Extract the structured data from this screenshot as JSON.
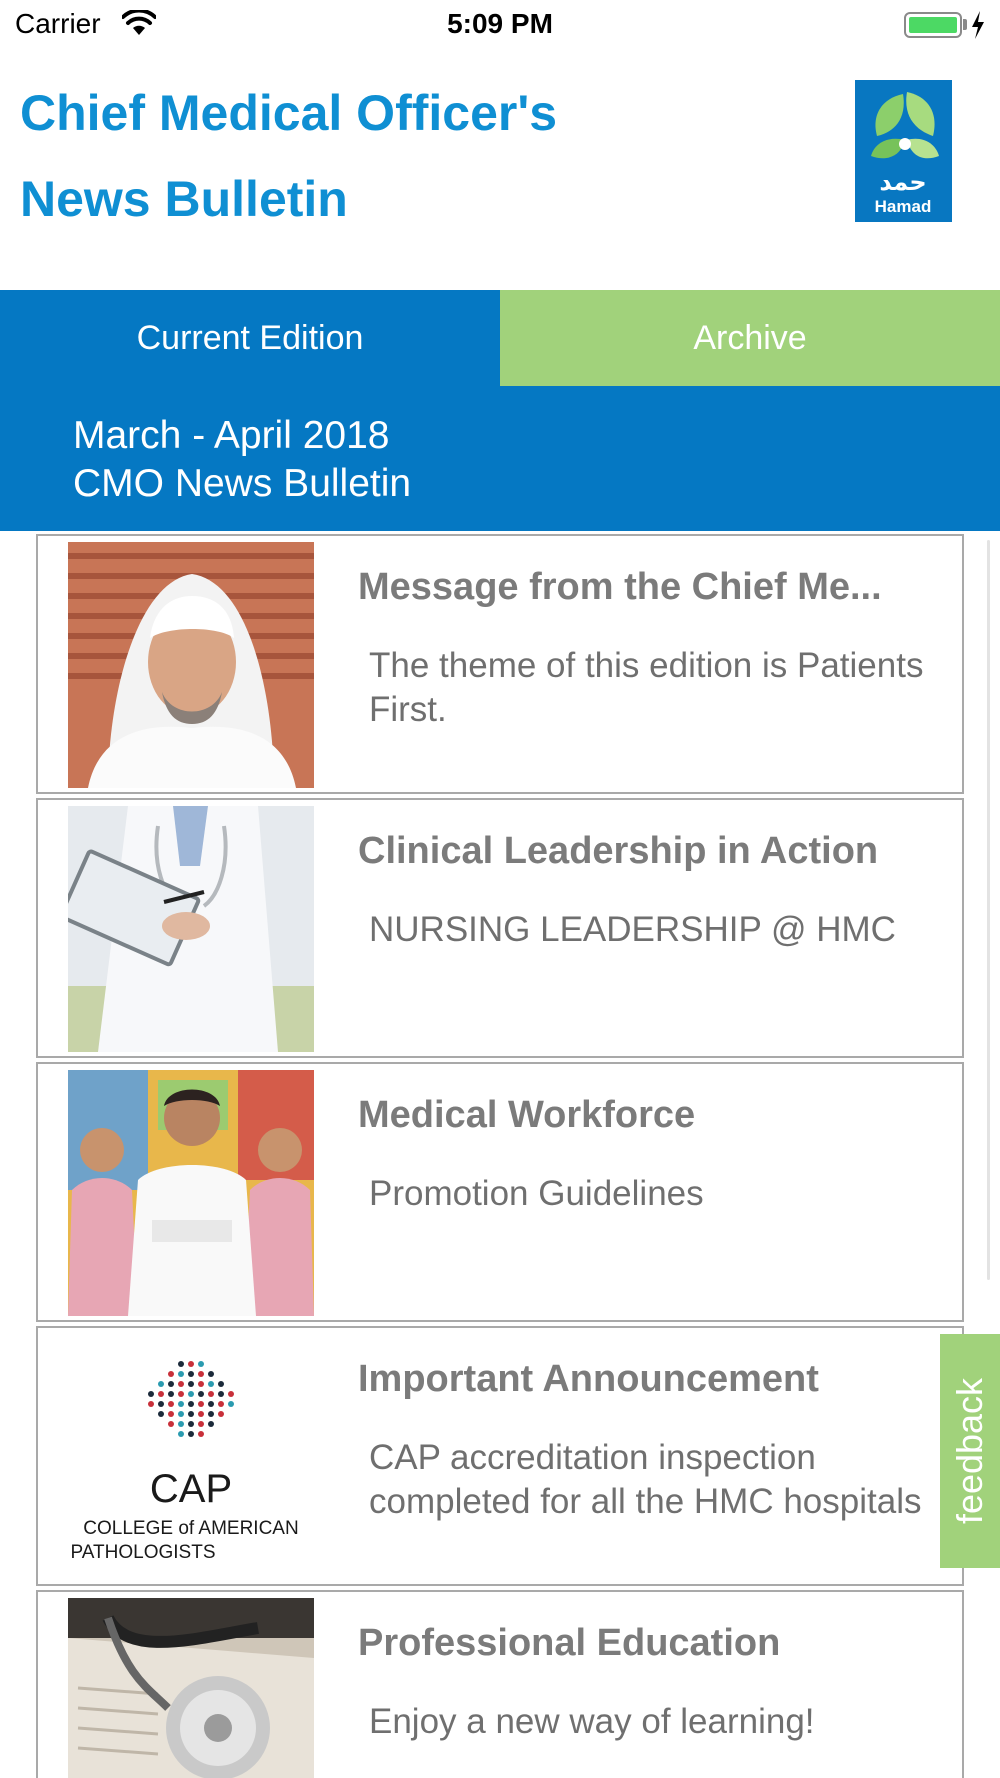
{
  "status_bar": {
    "carrier": "Carrier",
    "time": "5:09 PM",
    "battery_color": "#4cd964"
  },
  "header": {
    "title_line1": "Chief Medical Officer's",
    "title_line2": "News Bulletin",
    "logo_text": "Hamad",
    "logo_arabic": "حمد",
    "title_color": "#0f8fd3"
  },
  "tabs": [
    {
      "label": "Current Edition",
      "active": true,
      "color": "#0578c3"
    },
    {
      "label": "Archive",
      "active": false,
      "color": "#a1d27b"
    }
  ],
  "edition": {
    "line1": "March - April 2018",
    "line2": "CMO News Bulletin"
  },
  "articles": [
    {
      "title": "Message from the Chief Me...",
      "description": "The theme of this edition is Patients First.",
      "image": "cmo-portrait"
    },
    {
      "title": "Clinical Leadership in Action",
      "description": "NURSING LEADERSHIP @ HMC",
      "image": "doctor-clipboard"
    },
    {
      "title": "Medical Workforce",
      "description": "Promotion Guidelines",
      "image": "medical-staff-group"
    },
    {
      "title": "Important Announcement",
      "description": "CAP accreditation inspection completed for all the HMC hospitals",
      "image": "cap-logo",
      "logo_text": "CAP",
      "logo_sub1": "COLLEGE of AMERICAN",
      "logo_sub2": "PATHOLOGISTS"
    },
    {
      "title": "Professional Education",
      "description": "Enjoy a new way of learning!",
      "image": "stethoscope-book"
    }
  ],
  "feedback_label": "feedback"
}
